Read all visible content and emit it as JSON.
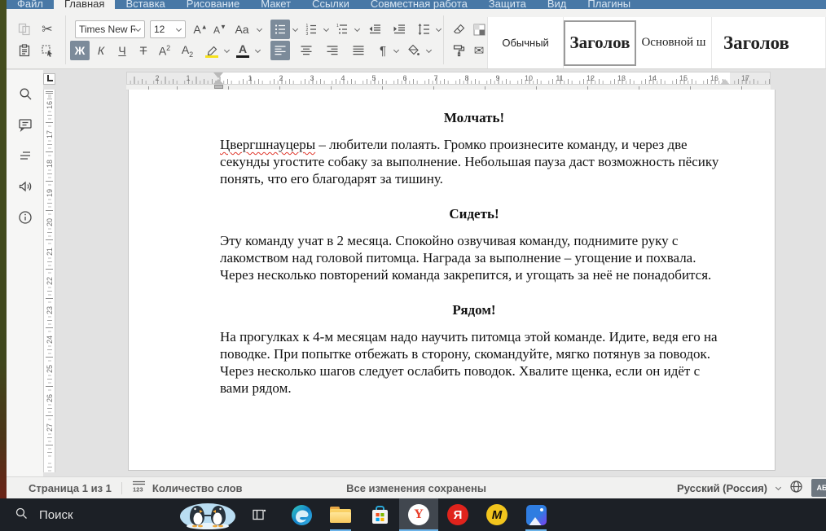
{
  "menu": {
    "tabs": [
      {
        "label": "Файл",
        "active": false
      },
      {
        "label": "Главная",
        "active": true
      },
      {
        "label": "Вставка",
        "active": false
      },
      {
        "label": "Рисование",
        "active": false
      },
      {
        "label": "Макет",
        "active": false
      },
      {
        "label": "Ссылки",
        "active": false
      },
      {
        "label": "Совместная работа",
        "active": false
      },
      {
        "label": "Защита",
        "active": false
      },
      {
        "label": "Вид",
        "active": false
      },
      {
        "label": "Плагины",
        "active": false
      }
    ]
  },
  "toolbar": {
    "font_family": "Times New R",
    "font_size": "12",
    "bold": "Ж",
    "italic": "К",
    "underline": "Ч",
    "strikethrough": "Т",
    "superscript_base": "А",
    "superscript_mark": "2",
    "subscript_base": "А",
    "subscript_mark": "2",
    "grow_font": "A",
    "shrink_font": "A",
    "case_label": "Aa",
    "font_color_label": "А",
    "pilcrow": "¶",
    "cut_glyph": "✂",
    "envelope_glyph": "✉",
    "styles": [
      {
        "label": "Обычный",
        "selected": false
      },
      {
        "label": "Заголов",
        "selected": true
      },
      {
        "label": "Основной ш",
        "selected": false
      },
      {
        "label": "Заголов",
        "selected": false
      }
    ]
  },
  "ruler": {
    "h_left": [
      "2",
      "1"
    ],
    "h_numbers": [
      "1",
      "2",
      "3",
      "4",
      "5",
      "6",
      "7",
      "8",
      "9",
      "10",
      "11",
      "12",
      "13",
      "14",
      "15",
      "16"
    ],
    "h_right": "17",
    "v_numbers": [
      "16",
      "17",
      "18",
      "19",
      "20",
      "21",
      "22",
      "23",
      "24",
      "25",
      "26",
      "27"
    ]
  },
  "document": {
    "sections": [
      {
        "heading": "Молчать!",
        "misspelled": "Цвергшнауцеры",
        "body": " – любители полаять. Громко произнесите команду, и через две секунды угостите собаку за выполнение. Небольшая пауза даст возможность пёсику понять, что его благодарят за тишину."
      },
      {
        "heading": "Сидеть!",
        "body": "Эту команду учат в 2 месяца. Спокойно озвучивая команду, поднимите руку с лакомством над головой питомца. Награда за выполнение – угощение и похвала. Через несколько повторений команда закрепится, и угощать за неё не понадобится."
      },
      {
        "heading": "Рядом!",
        "body": "На прогулках к 4-м месяцам надо научить питомца этой команде. Идите, ведя его на поводке. При попытке отбежать в сторону, скомандуйте, мягко потянув за поводок. Через несколько шагов следует ослабить поводок. Хвалите щенка, если он идёт с вами рядом."
      }
    ]
  },
  "statusbar": {
    "page": "Страница 1 из 1",
    "word_count": "Количество слов",
    "saved": "Все изменения сохранены",
    "language": "Русский (Россия)",
    "spell_badge": "АБ"
  },
  "taskbar": {
    "search_placeholder": "Поиск",
    "yandex_browser_glyph": "Y",
    "yandex_glyph": "Я",
    "myoffice_glyph": "M"
  },
  "colors": {
    "menubar_blue": "#4878a6",
    "active_toggle": "#7c8b9a",
    "running_underline": "#6cb3e8",
    "misspell_red": "#e0372c",
    "highlight_yellow": "#f6e11c"
  }
}
